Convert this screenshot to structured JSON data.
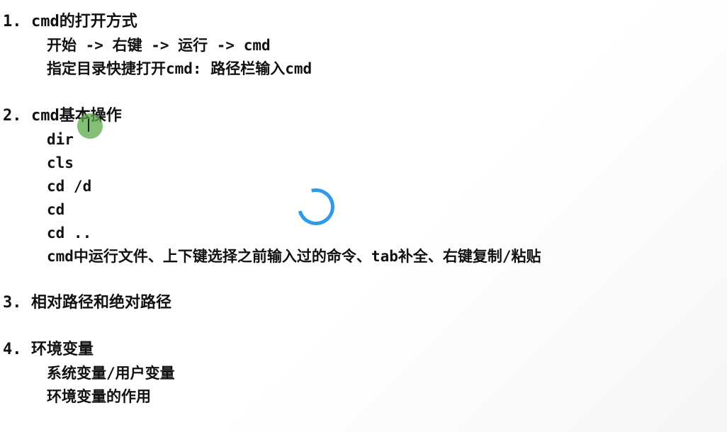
{
  "sections": [
    {
      "number": "1.",
      "title": "cmd的打开方式",
      "items": [
        "开始 -> 右键 -> 运行 -> cmd",
        "指定目录快捷打开cmd: 路径栏输入cmd"
      ]
    },
    {
      "number": "2.",
      "title": "cmd基本操作",
      "items": [
        "dir",
        "cls",
        "cd /d",
        "cd",
        "cd ..",
        "cmd中运行文件、上下键选择之前输入过的命令、tab补全、右键复制/粘贴"
      ]
    },
    {
      "number": "3.",
      "title": "相对路径和绝对路径",
      "items": []
    },
    {
      "number": "4.",
      "title": "环境变量",
      "items": [
        "系统变量/用户变量",
        "环境变量的作用"
      ]
    }
  ],
  "overlay": {
    "cursor_icon": "ibeam-cursor-icon",
    "loading_icon": "loading-spinner-icon",
    "accent_color": "#2f9be8",
    "cursor_highlight_color": "#5aaa46"
  }
}
